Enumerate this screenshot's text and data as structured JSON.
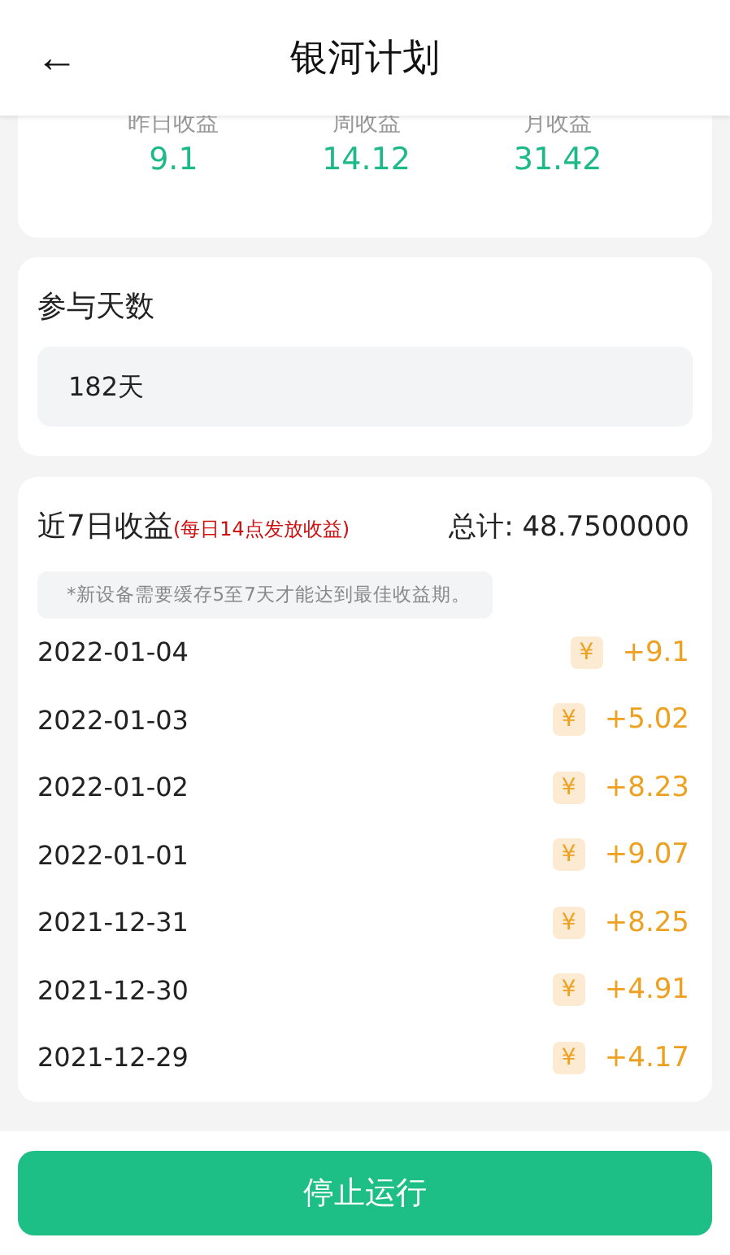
{
  "header": {
    "title": "银河计划",
    "back": "←"
  },
  "stats": [
    {
      "label": "昨日收益",
      "value": "9.1"
    },
    {
      "label": "周收益",
      "value": "14.12"
    },
    {
      "label": "月收益",
      "value": "31.42"
    }
  ],
  "days": {
    "label": "参与天数",
    "value": "182天"
  },
  "earnings": {
    "title": "近7日收益",
    "note": "(每日14点发放收益)",
    "total": "总计: 48.7500000",
    "tip": "*新设备需要缓存5至7天才能达到最佳收益期。",
    "currency": "¥",
    "rows": [
      {
        "date": "2022-01-04",
        "amount": "+9.1"
      },
      {
        "date": "2022-01-03",
        "amount": "+5.02"
      },
      {
        "date": "2022-01-02",
        "amount": "+8.23"
      },
      {
        "date": "2022-01-01",
        "amount": "+9.07"
      },
      {
        "date": "2021-12-31",
        "amount": "+8.25"
      },
      {
        "date": "2021-12-30",
        "amount": "+4.91"
      },
      {
        "date": "2021-12-29",
        "amount": "+4.17"
      }
    ]
  },
  "button": "停止运行"
}
